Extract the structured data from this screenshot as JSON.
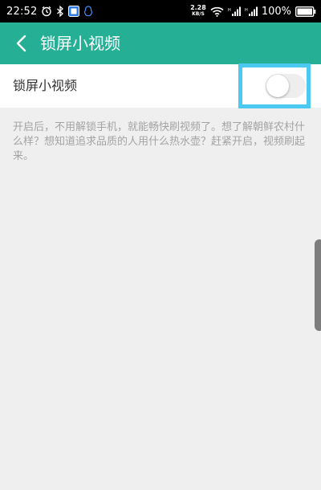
{
  "status_bar": {
    "time": "22:52",
    "net_speed_value": "2.28",
    "net_speed_unit": "KB/S",
    "battery_text": "100%",
    "icons": [
      "alarm-icon",
      "bluetooth-icon",
      "app-notification-icon",
      "qq-icon",
      "wifi-icon",
      "signal-icon",
      "signal-icon-2",
      "battery-icon"
    ]
  },
  "header": {
    "back_icon": "chevron-left-icon",
    "title": "锁屏小视频",
    "background_color": "#25b095"
  },
  "setting": {
    "label": "锁屏小视频",
    "toggle_state": "off",
    "highlight_color": "#4cc9f0"
  },
  "description": "开启后，不用解锁手机，就能畅快刷视频了。想了解朝鲜农村什么样？想知道追求品质的人用什么热水壶？赶紧开启，视频刷起来。"
}
